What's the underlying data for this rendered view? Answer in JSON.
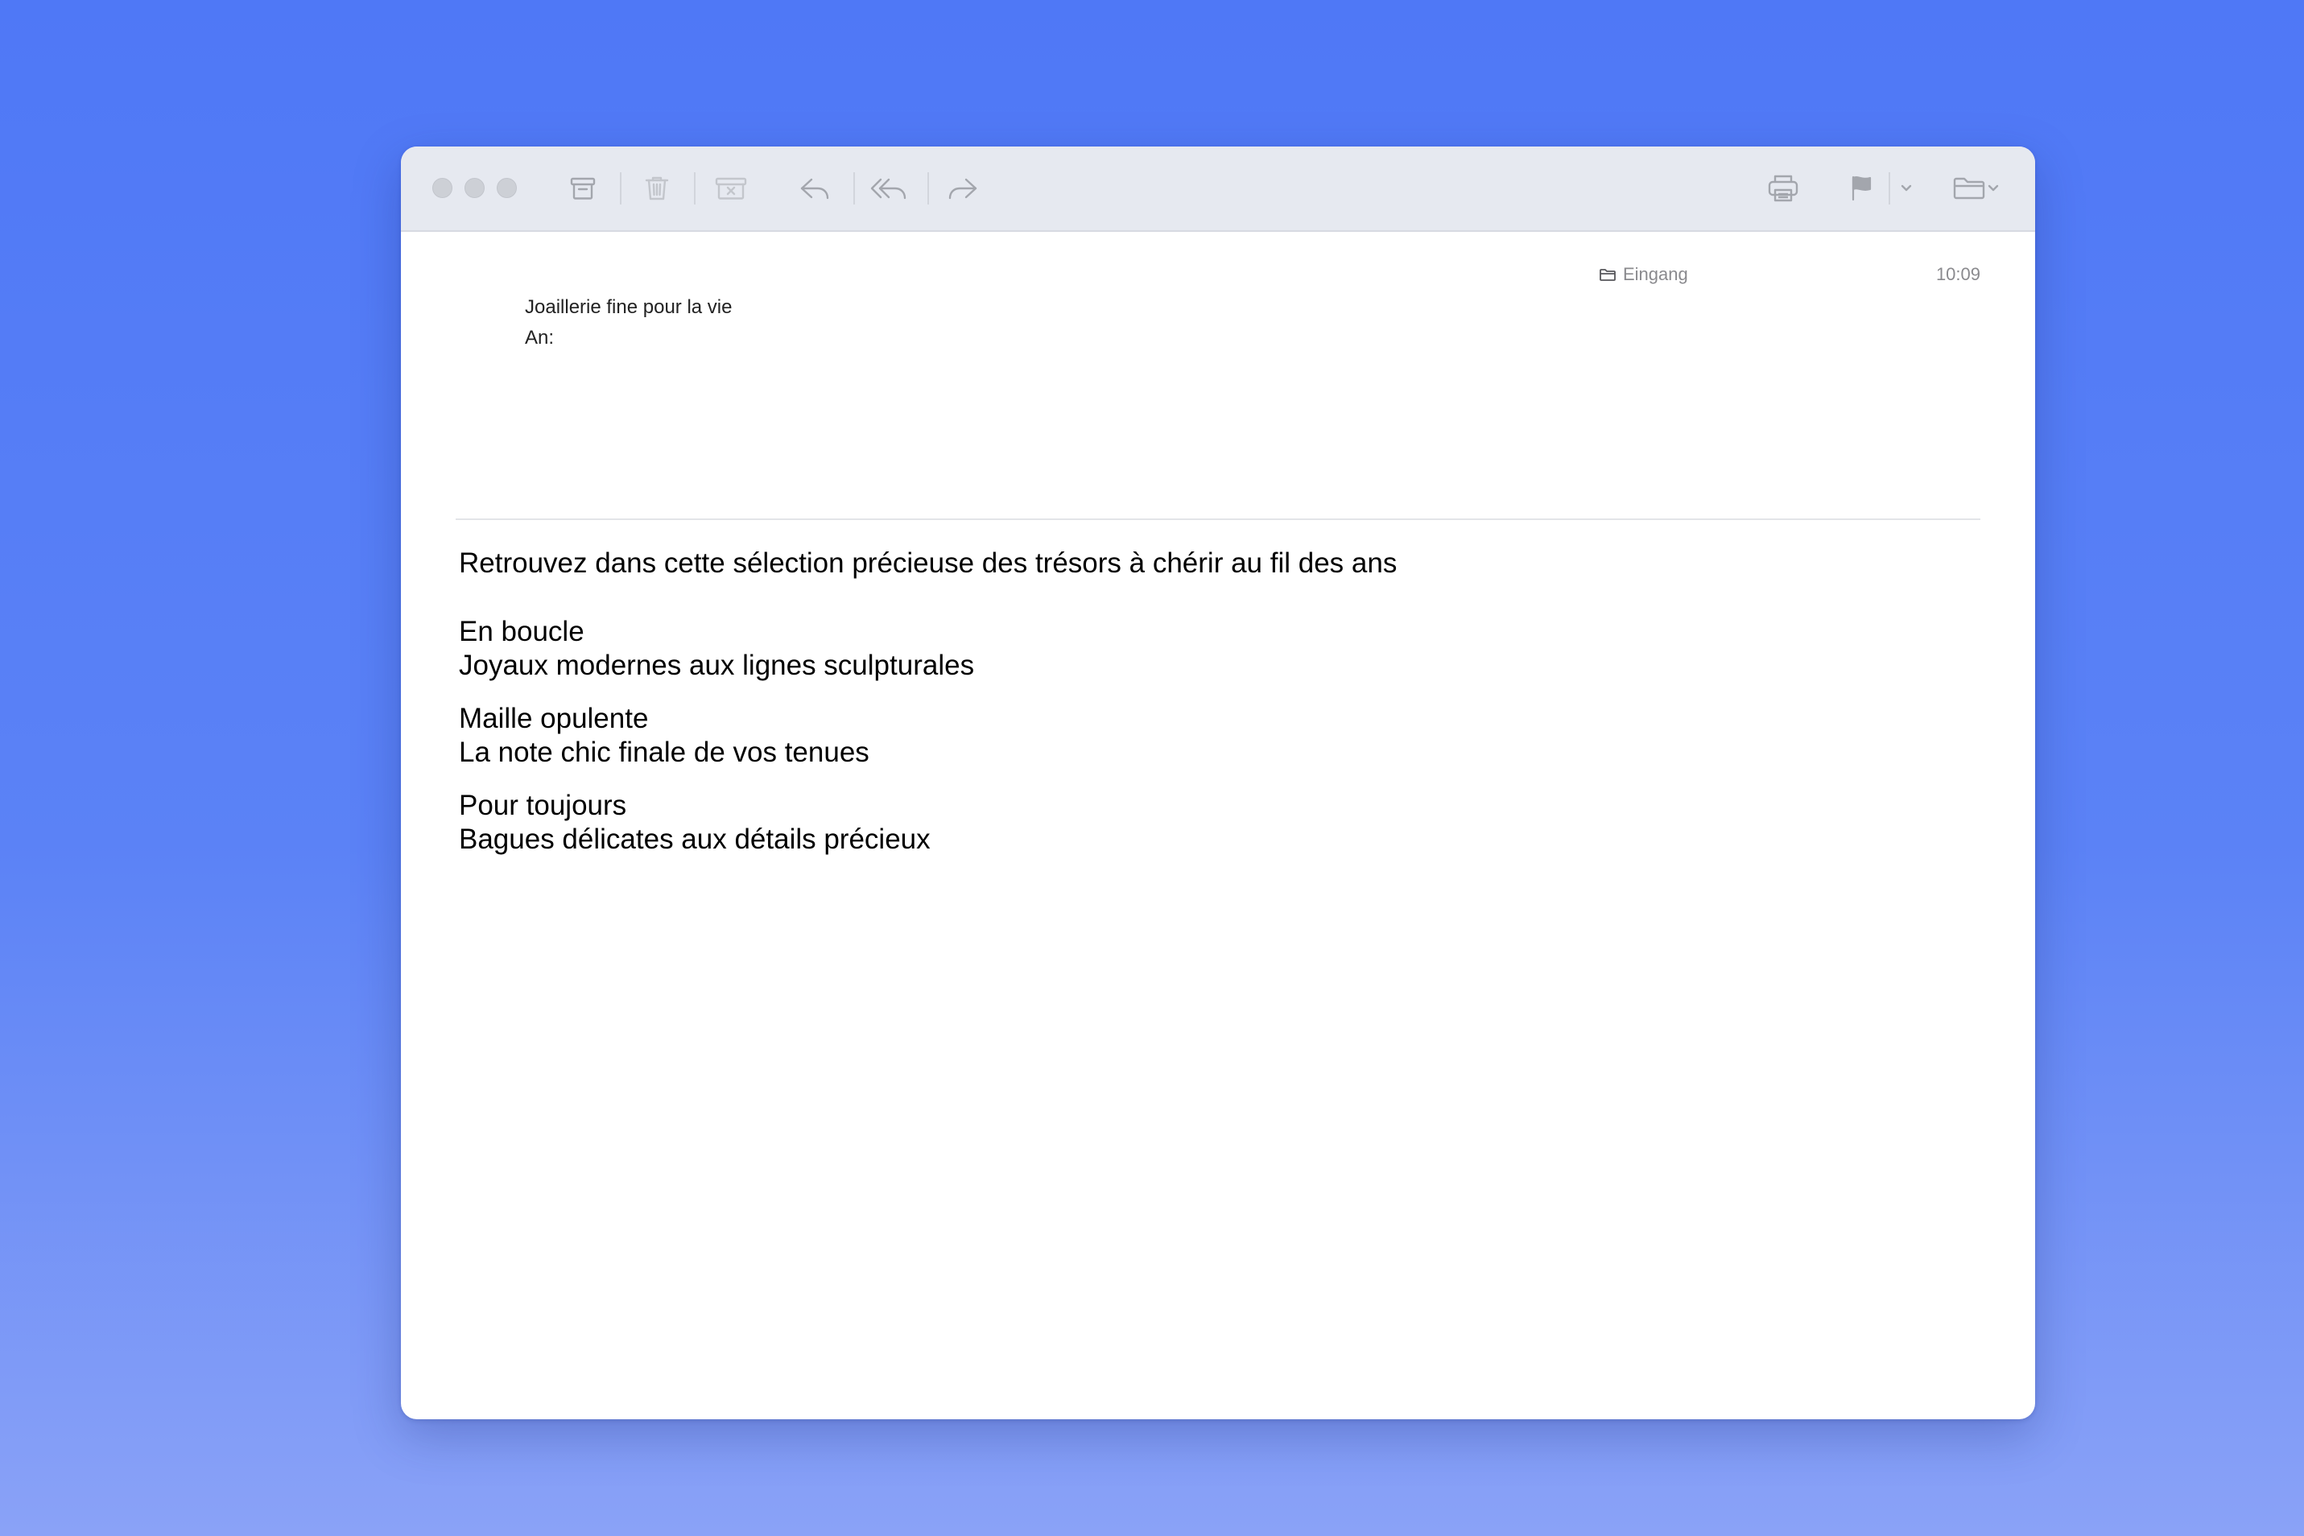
{
  "window": {
    "buttons": {
      "close": "close",
      "minimize": "minimize",
      "zoom": "zoom"
    }
  },
  "toolbar": {
    "icons": [
      "archive-icon",
      "trash-icon",
      "junk-icon",
      "reply-icon",
      "reply-all-icon",
      "forward-icon",
      "print-icon",
      "flag-icon",
      "flag-dropdown-icon",
      "move-folder-icon",
      "move-dropdown-icon"
    ]
  },
  "header": {
    "sender": "Joaillerie fine pour la vie",
    "to_label": "An:",
    "mailbox": "Eingang",
    "time": "10:09"
  },
  "message": {
    "intro": "Retrouvez dans cette sélection précieuse des trésors à chérir au fil des ans",
    "sections": [
      {
        "title": "En boucle",
        "subtitle": "Joyaux modernes aux lignes sculpturales"
      },
      {
        "title": "Maille opulente",
        "subtitle": "La note chic finale de vos tenues"
      },
      {
        "title": "Pour toujours",
        "subtitle": "Bagues délicates aux détails précieux"
      }
    ]
  },
  "colors": {
    "background_top": "#4f78f6",
    "background_bottom": "#8aa2f7",
    "toolbar": "#e6e9f0",
    "icon": "#a3a6ad",
    "meta_text": "#8a8a8e"
  }
}
